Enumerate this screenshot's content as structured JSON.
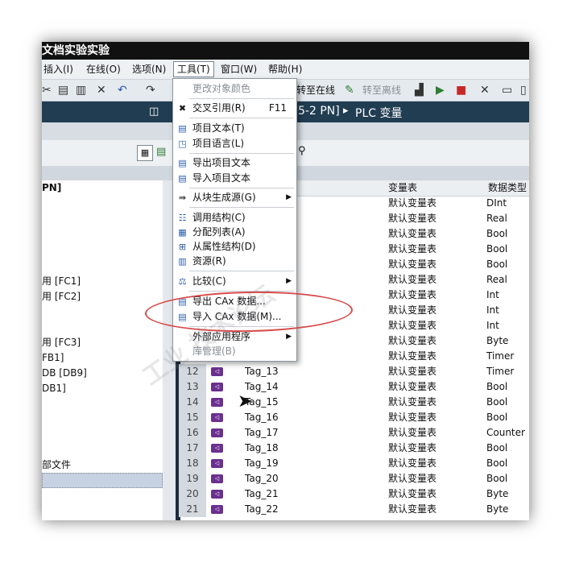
{
  "window": {
    "title": "文档实验实验"
  },
  "menu": {
    "items": [
      "插入(I)",
      "在线(O)",
      "选项(N)",
      "工具(T)",
      "窗口(W)",
      "帮助(H)"
    ]
  },
  "toolbar": {
    "go_online": "转至在线",
    "go_offline": "转至离线"
  },
  "breadcrumb": {
    "device": "5-2 PN]",
    "sep": "▸",
    "section": "PLC 变量"
  },
  "left_panel": {
    "header": "PN]",
    "items": [
      "用 [FC1]",
      "用 [FC2]",
      "用 [FC3]",
      "FB1]",
      "DB [DB9]",
      "DB1]",
      "部文件"
    ]
  },
  "table": {
    "col_var_table": "变量表",
    "col_data_type": "数据类型",
    "rows_top": [
      {
        "table": "默认变量表",
        "type": "DInt"
      },
      {
        "table": "默认变量表",
        "type": "Real"
      },
      {
        "table": "默认变量表",
        "type": "Bool"
      },
      {
        "table": "默认变量表",
        "type": "Bool"
      },
      {
        "table": "默认变量表",
        "type": "Bool"
      },
      {
        "table": "默认变量表",
        "type": "Real"
      },
      {
        "table": "默认变量表",
        "type": "Int"
      },
      {
        "table": "默认变量表",
        "type": "Int"
      },
      {
        "table": "默认变量表",
        "type": "Int"
      },
      {
        "table": "默认变量表",
        "type": "Byte"
      },
      {
        "table": "默认变量表",
        "type": "Timer"
      }
    ],
    "rows": [
      {
        "num": "12",
        "name": "Tag_13",
        "table": "默认变量表",
        "type": "Timer"
      },
      {
        "num": "13",
        "name": "Tag_14",
        "table": "默认变量表",
        "type": "Bool"
      },
      {
        "num": "14",
        "name": "Tag_15",
        "table": "默认变量表",
        "type": "Bool"
      },
      {
        "num": "15",
        "name": "Tag_16",
        "table": "默认变量表",
        "type": "Bool"
      },
      {
        "num": "16",
        "name": "Tag_17",
        "table": "默认变量表",
        "type": "Counter"
      },
      {
        "num": "17",
        "name": "Tag_18",
        "table": "默认变量表",
        "type": "Bool"
      },
      {
        "num": "18",
        "name": "Tag_19",
        "table": "默认变量表",
        "type": "Bool"
      },
      {
        "num": "19",
        "name": "Tag_20",
        "table": "默认变量表",
        "type": "Bool"
      },
      {
        "num": "20",
        "name": "Tag_21",
        "table": "默认变量表",
        "type": "Byte"
      },
      {
        "num": "21",
        "name": "Tag_22",
        "table": "默认变量表",
        "type": "Byte"
      }
    ]
  },
  "tools_menu": {
    "change_color": "更改对象颜色",
    "cross_ref": "交叉引用(R)",
    "cross_ref_shortcut": "F11",
    "project_text": "项目文本(T)",
    "project_lang": "项目语言(L)",
    "export_text": "导出项目文本",
    "import_text": "导入项目文本",
    "gen_source": "从块生成源(G)",
    "call_struct": "调用结构(C)",
    "assign_list": "分配列表(A)",
    "dep_struct": "从属性结构(D)",
    "resources": "资源(R)",
    "compare": "比较(C)",
    "export_cax": "导出 CAx 数据...",
    "import_cax": "导入 CAx 数据(M)...",
    "ext_apps": "外部应用程序",
    "lib_mgmt": "库管理(B)"
  },
  "icons": [
    "cut-icon",
    "copy-icon",
    "paste-icon",
    "delete-icon",
    "undo-icon",
    "redo-icon",
    "mouse-pointer-icon"
  ],
  "colors": {
    "menu_highlight_oval": "#d84c4c",
    "dark_header": "#213d52",
    "tag_icon": "#6a2f8f"
  }
}
